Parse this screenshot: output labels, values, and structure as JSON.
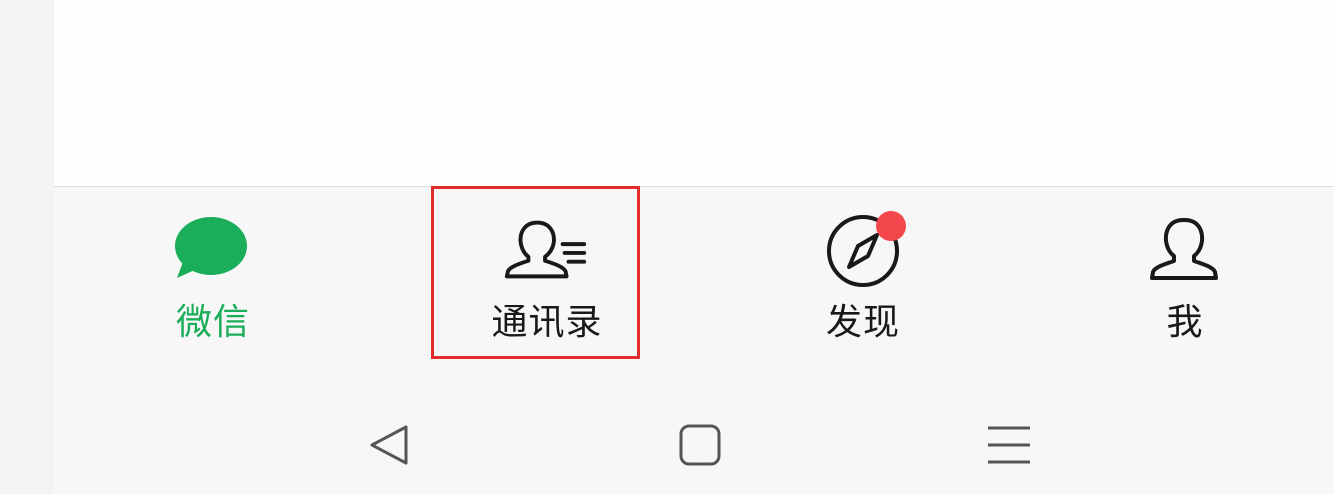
{
  "tabs": [
    {
      "label": "微信",
      "icon": "chat-bubble-icon",
      "active": true
    },
    {
      "label": "通讯录",
      "icon": "contacts-icon",
      "active": false
    },
    {
      "label": "发现",
      "icon": "compass-icon",
      "active": false,
      "badge": "red-dot"
    },
    {
      "label": "我",
      "icon": "person-icon",
      "active": false
    }
  ],
  "nav": {
    "back_icon": "back-triangle-icon",
    "home_icon": "home-square-icon",
    "menu_icon": "menu-lines-icon"
  },
  "colors": {
    "active_green": "#1aad5a",
    "icon_dark": "#191919",
    "badge_red": "#f4474b",
    "highlight_red": "#e22b2b",
    "nav_icon_gray": "#555555"
  }
}
